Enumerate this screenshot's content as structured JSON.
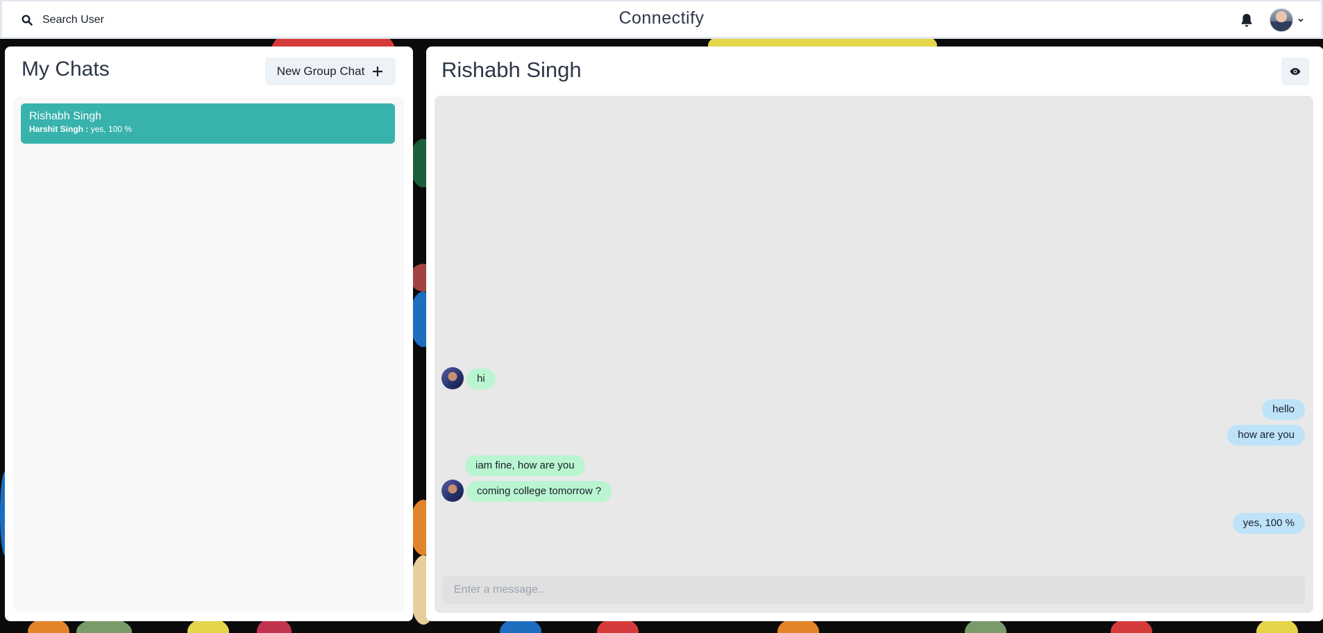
{
  "header": {
    "search_label": "Search User",
    "app_title": "Connectify"
  },
  "sidebar": {
    "title": "My Chats",
    "new_group_label": "New Group Chat",
    "chats": [
      {
        "name": "Rishabh Singh",
        "latest_sender": "Harshit Singh :",
        "latest_message": "yes, 100 %",
        "selected": true
      }
    ]
  },
  "chat": {
    "title": "Rishabh Singh",
    "messages": [
      {
        "text": "hi",
        "direction": "in"
      },
      {
        "text": "hello",
        "direction": "out"
      },
      {
        "text": "how are you",
        "direction": "out"
      },
      {
        "text": "iam fine, how are you",
        "direction": "in"
      },
      {
        "text": "coming college tomorrow ?",
        "direction": "in"
      },
      {
        "text": "yes, 100 %",
        "direction": "out"
      }
    ],
    "input_placeholder": "Enter a message.."
  },
  "colors": {
    "selected_chat": "#38b2ac",
    "incoming_bubble": "#b9f5d0",
    "outgoing_bubble": "#bee3f8"
  },
  "icons": [
    "search-icon",
    "bell-icon",
    "chevron-down-icon",
    "plus-icon",
    "eye-icon"
  ]
}
